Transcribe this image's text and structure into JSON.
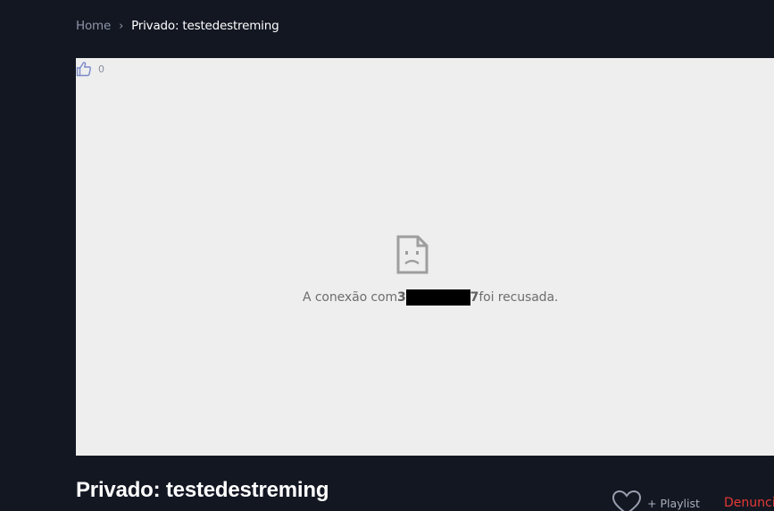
{
  "breadcrumb": {
    "home": "Home",
    "separator": "›",
    "current": "Privado: testedestreming"
  },
  "player": {
    "like_count": "0",
    "error": {
      "prefix": "A conexão com ",
      "host_start": "3",
      "host_end": "7",
      "suffix": " foi recusada."
    }
  },
  "video": {
    "title": "Privado: testedestreming",
    "playlist_label": "+ Playlist",
    "report_label": "Denunciar"
  },
  "colors": {
    "background": "#131722",
    "player_background": "#eeeeee",
    "report": "#e53935"
  },
  "icons": [
    "thumbs-up-icon",
    "sad-file-icon",
    "heart-icon"
  ]
}
